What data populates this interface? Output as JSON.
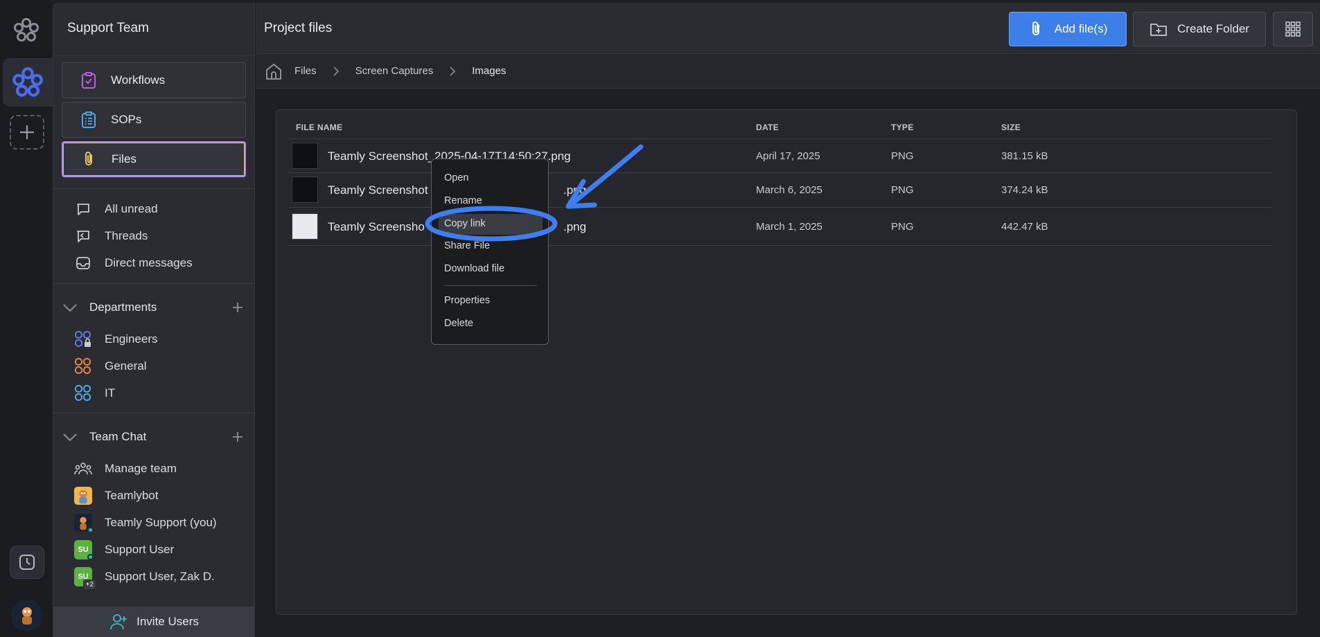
{
  "sidebar": {
    "team_name": "Support Team",
    "cards": [
      {
        "label": "Workflows"
      },
      {
        "label": "SOPs"
      },
      {
        "label": "Files"
      }
    ],
    "nav": [
      {
        "label": "All unread"
      },
      {
        "label": "Threads"
      },
      {
        "label": "Direct messages"
      }
    ],
    "departments": {
      "title": "Departments",
      "items": [
        {
          "label": "Engineers"
        },
        {
          "label": "General"
        },
        {
          "label": "IT"
        }
      ]
    },
    "team_chat": {
      "title": "Team Chat",
      "items": [
        {
          "label": "Manage team"
        },
        {
          "label": "Teamlybot"
        },
        {
          "label": "Teamly Support (you)"
        },
        {
          "label": "Support User",
          "initials": "SU"
        },
        {
          "label": "Support User, Zak D.",
          "initials": "SU",
          "extra": "+2"
        }
      ]
    },
    "invite_label": "Invite Users"
  },
  "header": {
    "title": "Project files",
    "add_files_label": "Add file(s)",
    "create_folder_label": "Create Folder"
  },
  "breadcrumb": [
    "Files",
    "Screen Captures",
    "Images"
  ],
  "table": {
    "columns": [
      "FILE NAME",
      "DATE",
      "TYPE",
      "SIZE"
    ],
    "rows": [
      {
        "name": "Teamly Screenshot_2025-04-17T14:50:27.png",
        "date": "April 17, 2025",
        "type": "PNG",
        "size": "381.15 kB"
      },
      {
        "name_start": "Teamly Screenshot",
        "name_end": ".png",
        "date": "March 6, 2025",
        "type": "PNG",
        "size": "374.24 kB"
      },
      {
        "name_start": "Teamly Screensho",
        "name_end": ".png",
        "date": "March 1, 2025",
        "type": "PNG",
        "size": "442.47 kB"
      }
    ]
  },
  "context_menu": {
    "items": [
      "Open",
      "Rename",
      "Copy link",
      "Share File",
      "Download file",
      "Properties",
      "Delete"
    ],
    "highlighted": "Copy link"
  },
  "colors": {
    "accent": "#3d7fe8",
    "annotation": "#3f7ef0",
    "active_border": "#a98aff"
  }
}
